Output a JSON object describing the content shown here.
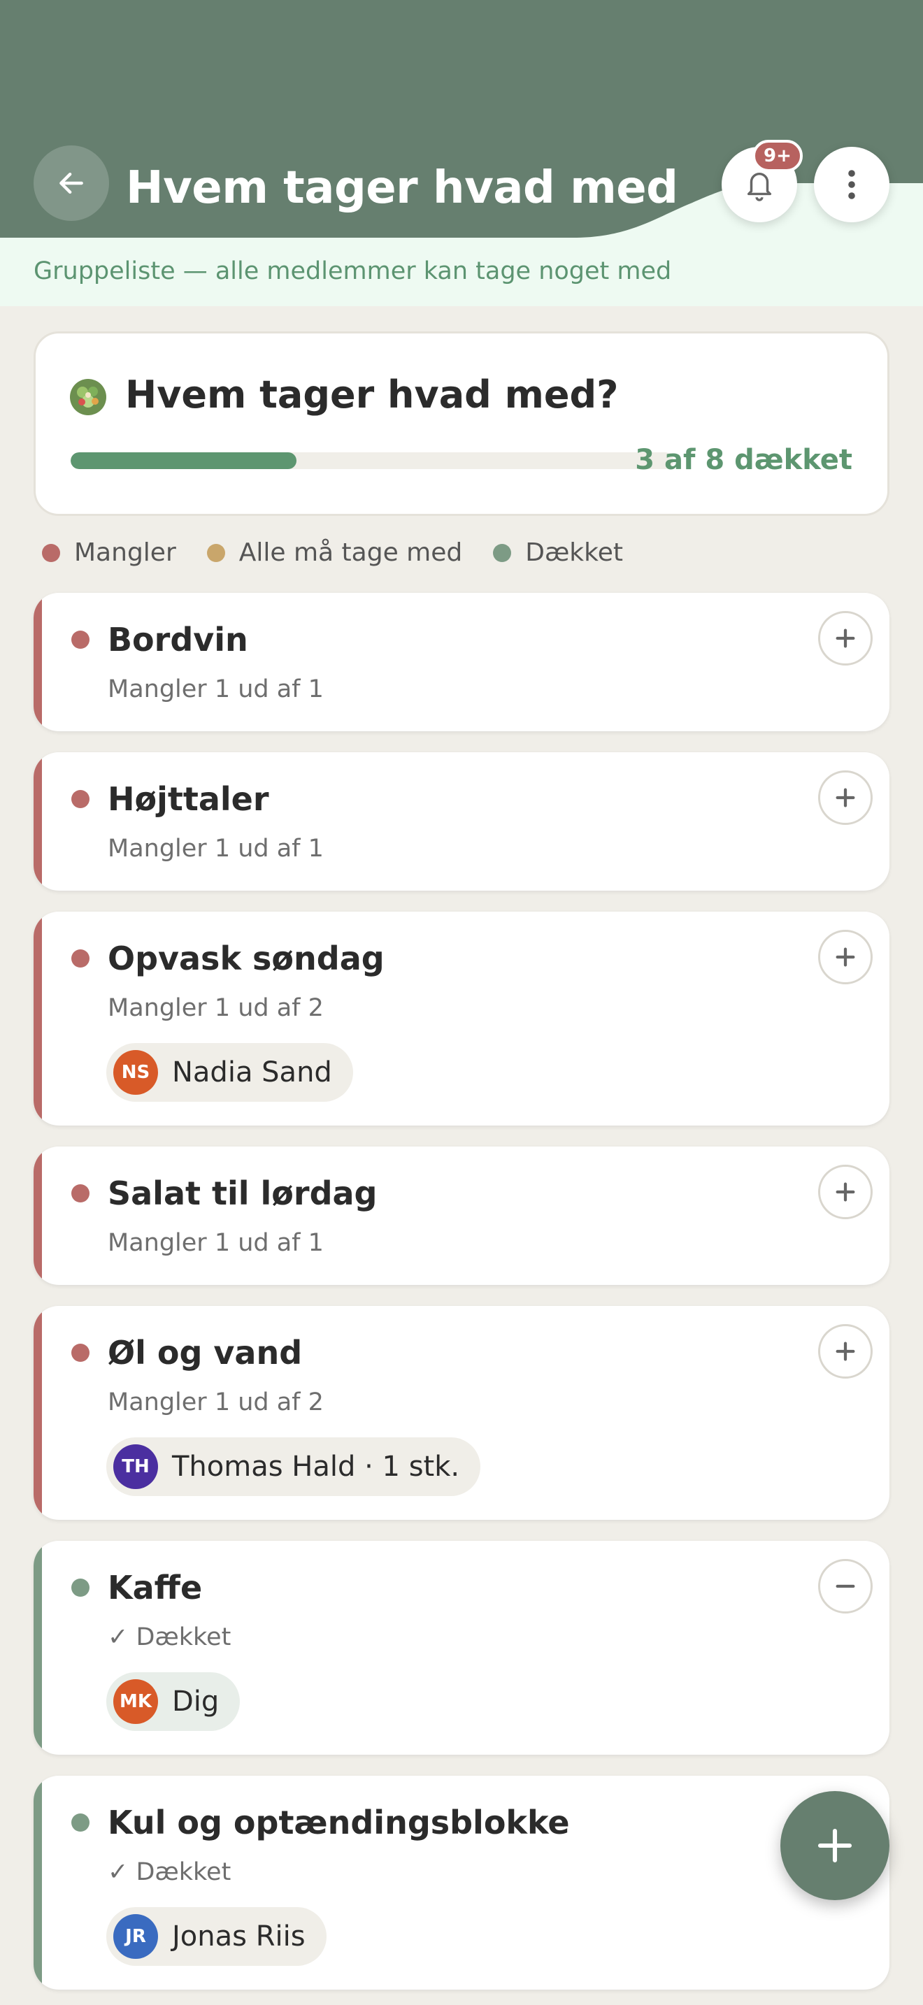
{
  "header": {
    "title": "Hvem tager hvad med",
    "notification_badge": "9+",
    "subtitle": "Gruppeliste — alle medlemmer kan tage noget med"
  },
  "summary": {
    "title": "Hvem tager hvad med?",
    "emoji_icon": "salad-icon",
    "progress_fraction": 0.375,
    "count_label": "3 af 8 dækket"
  },
  "legend": [
    {
      "label": "Mangler",
      "color": "#b96b68"
    },
    {
      "label": "Alle må tage med",
      "color": "#c9a66b"
    },
    {
      "label": "Dækket",
      "color": "#7d9b85"
    }
  ],
  "colors": {
    "missing": "#b96b68",
    "covered": "#7d9b85",
    "header": "#667f6f",
    "accent_text": "#5d9670"
  },
  "items": [
    {
      "title": "Bordvin",
      "status": "Mangler 1 ud af 1",
      "state": "missing",
      "action_icon": "plus-icon"
    },
    {
      "title": "Højttaler",
      "status": "Mangler 1 ud af 1",
      "state": "missing",
      "action_icon": "plus-icon"
    },
    {
      "title": "Opvask søndag",
      "status": "Mangler 1 ud af 2",
      "state": "missing",
      "action_icon": "plus-icon",
      "assignee": {
        "initials": "NS",
        "name": "Nadia Sand",
        "color": "#d85a28"
      }
    },
    {
      "title": "Salat til lørdag",
      "status": "Mangler 1 ud af 1",
      "state": "missing",
      "action_icon": "plus-icon"
    },
    {
      "title": "Øl og vand",
      "status": "Mangler 1 ud af 2",
      "state": "missing",
      "action_icon": "plus-icon",
      "assignee": {
        "initials": "TH",
        "name": "Thomas Hald · 1 stk.",
        "color": "#4b2fa0"
      }
    },
    {
      "title": "Kaffe",
      "status": "✓ Dækket",
      "state": "covered",
      "action_icon": "minus-icon",
      "assignee": {
        "initials": "MK",
        "name": "Dig",
        "color": "#d85a28"
      }
    },
    {
      "title": "Kul og optændingsblokke",
      "status": "✓ Dækket",
      "state": "covered",
      "assignee": {
        "initials": "JR",
        "name": "Jonas Riis",
        "color": "#3a6bc0"
      }
    }
  ],
  "fab": {
    "icon": "plus-icon"
  }
}
